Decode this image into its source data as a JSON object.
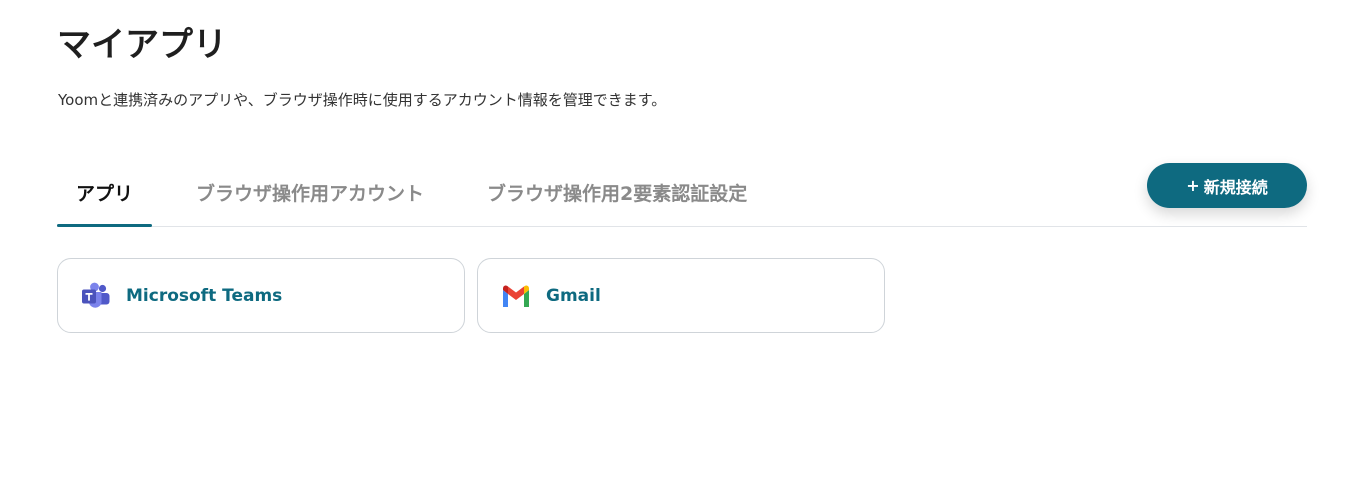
{
  "header": {
    "title": "マイアプリ",
    "description": "Yoomと連携済みのアプリや、ブラウザ操作時に使用するアカウント情報を管理できます。"
  },
  "tabs": [
    {
      "label": "アプリ",
      "active": true
    },
    {
      "label": "ブラウザ操作用アカウント",
      "active": false
    },
    {
      "label": "ブラウザ操作用2要素認証設定",
      "active": false
    }
  ],
  "actions": {
    "new_connection_plus": "+",
    "new_connection_label": "新規接続"
  },
  "apps": [
    {
      "name": "Microsoft Teams",
      "icon": "microsoft-teams-icon"
    },
    {
      "name": "Gmail",
      "icon": "gmail-icon"
    }
  ],
  "colors": {
    "accent": "#0e6a80",
    "teams_purple": "#5059c9",
    "gmail_red": "#ea4335"
  }
}
